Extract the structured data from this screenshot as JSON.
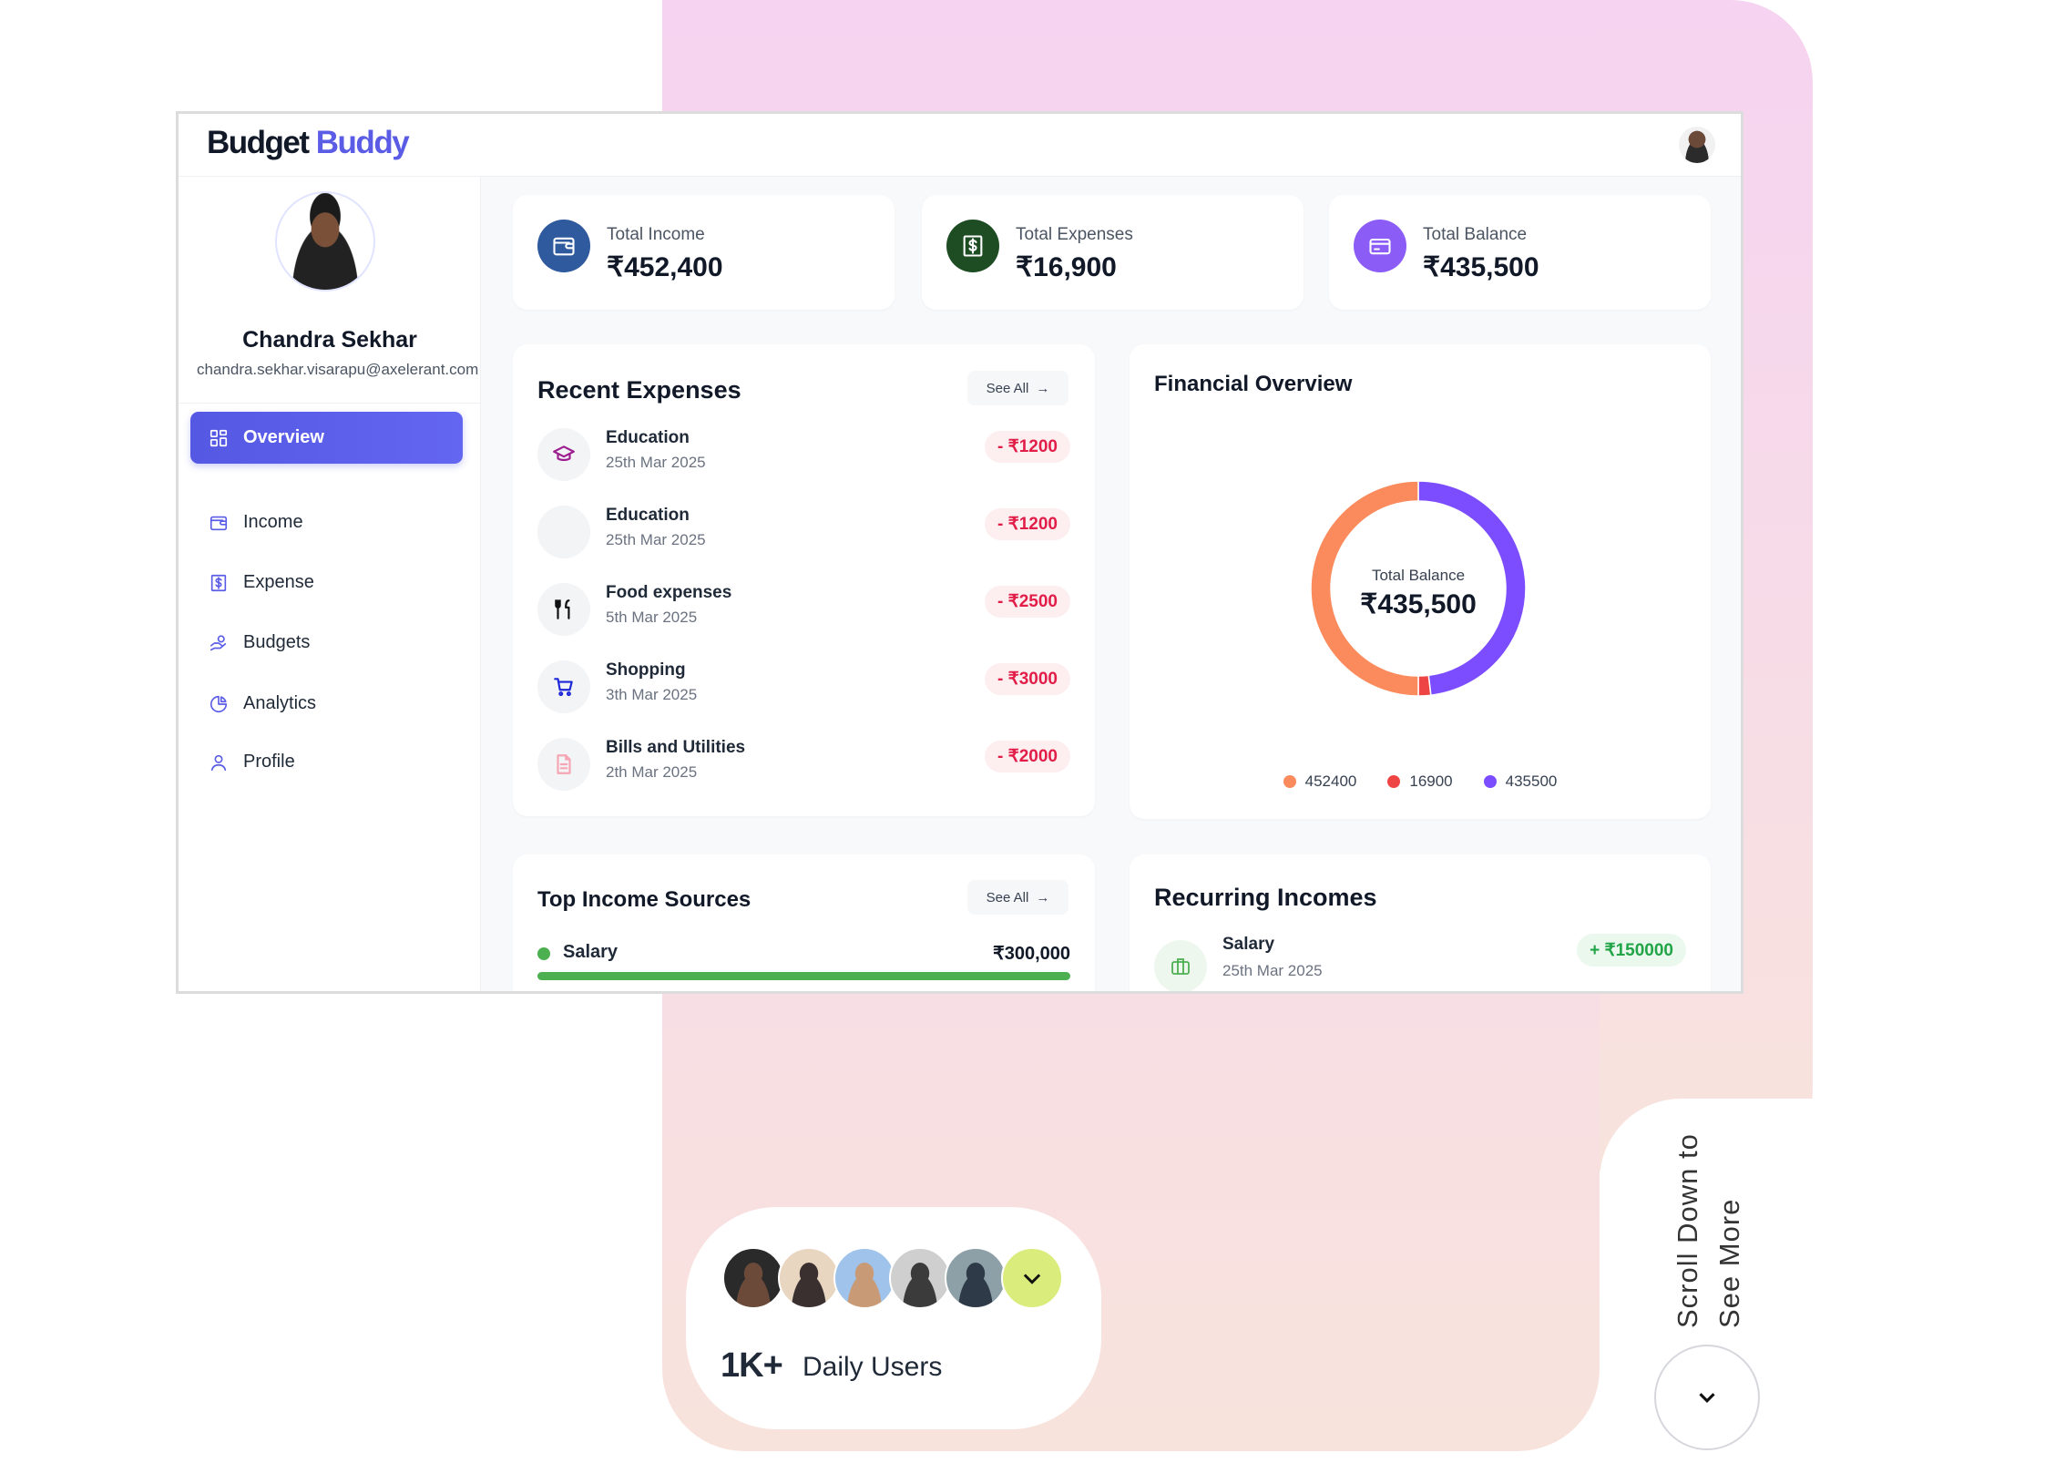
{
  "app": {
    "brand_part1": "Budget",
    "brand_part2": "Buddy"
  },
  "profile": {
    "name": "Chandra Sekhar",
    "email": "chandra.sekhar.visarapu@axelerant.com"
  },
  "sidebar": {
    "items": [
      {
        "label": "Overview",
        "icon": "grid-icon",
        "active": true
      },
      {
        "label": "Income",
        "icon": "wallet-icon"
      },
      {
        "label": "Expense",
        "icon": "dollar-bill-icon"
      },
      {
        "label": "Budgets",
        "icon": "hand-coins-icon"
      },
      {
        "label": "Analytics",
        "icon": "pie-chart-icon"
      },
      {
        "label": "Profile",
        "icon": "user-icon"
      }
    ]
  },
  "stats": [
    {
      "label": "Total Income",
      "value": "₹452,400",
      "color": "#2f5a9e",
      "icon": "wallet-icon"
    },
    {
      "label": "Total Expenses",
      "value": "₹16,900",
      "color": "#1e4d24",
      "icon": "dollar-bill-icon"
    },
    {
      "label": "Total Balance",
      "value": "₹435,500",
      "color": "#8b5cf6",
      "icon": "credit-card-icon"
    }
  ],
  "recent_expenses": {
    "title": "Recent Expenses",
    "see_all": "See All",
    "items": [
      {
        "name": "Education",
        "date": "25th Mar 2025",
        "amount": "- ₹1200",
        "icon": "graduation-cap-icon"
      },
      {
        "name": "Education",
        "date": "25th Mar 2025",
        "amount": "- ₹1200",
        "icon": ""
      },
      {
        "name": "Food expenses",
        "date": "5th Mar 2025",
        "amount": "- ₹2500",
        "icon": "fork-knife-icon"
      },
      {
        "name": "Shopping",
        "date": "3th Mar 2025",
        "amount": "- ₹3000",
        "icon": "cart-icon"
      },
      {
        "name": "Bills and Utilities",
        "date": "2th Mar 2025",
        "amount": "- ₹2000",
        "icon": "document-icon"
      }
    ]
  },
  "financial_overview": {
    "title": "Financial Overview",
    "center_label": "Total Balance",
    "center_value": "₹435,500"
  },
  "chart_data": {
    "type": "pie",
    "donut": true,
    "values": [
      452400,
      16900,
      435500
    ],
    "categories": [
      "452400",
      "16900",
      "435500"
    ],
    "colors": [
      "#fb8a5c",
      "#ef4444",
      "#7c4dff"
    ],
    "legend": "bottom"
  },
  "top_income": {
    "title": "Top Income Sources",
    "see_all": "See All",
    "items": [
      {
        "name": "Salary",
        "amount": "₹300,000",
        "progress": 100,
        "color": "#4caf50"
      }
    ]
  },
  "recurring": {
    "title": "Recurring Incomes",
    "items": [
      {
        "name": "Salary",
        "date": "25th Mar 2025",
        "amount": "+ ₹150000",
        "icon": "briefcase-icon"
      }
    ]
  },
  "promo": {
    "count": "1K+",
    "label": "Daily Users",
    "scroll_line1": "Scroll Down to",
    "scroll_line2": "See More"
  }
}
